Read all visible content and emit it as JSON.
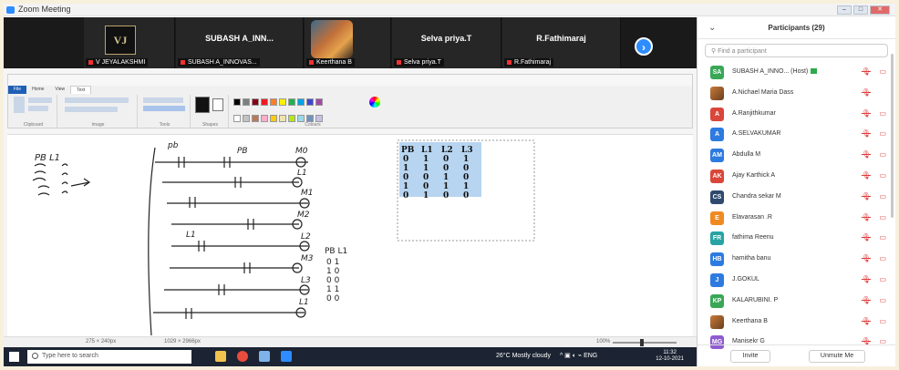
{
  "window": {
    "title": "Zoom Meeting"
  },
  "video_strip": {
    "tiles": [
      {
        "display": "VJ",
        "name": "V JEYALAKSHMI"
      },
      {
        "display": "SUBASH A_INN...",
        "name": "SUBASH A_INNOVAS..."
      },
      {
        "display": "",
        "name": "Keerthana B"
      },
      {
        "display": "Selva priya.T",
        "name": "Selva priya.T"
      },
      {
        "display": "R.Fathimaraj",
        "name": "R.Fathimaraj"
      }
    ],
    "next_glyph": "›"
  },
  "paint": {
    "tabs": [
      "File",
      "Home",
      "View",
      "Text"
    ],
    "groups": [
      "Clipboard",
      "Image",
      "Tools",
      "Shapes",
      "Colours"
    ],
    "status": {
      "pos1": "275 × 240px",
      "pos2": "1029 × 2966px",
      "zoom": "100%"
    }
  },
  "whiteboard": {
    "left_table_header": "PB  L1",
    "right_table_header": "PB  L1",
    "right_table_rows": [
      "0   1",
      "1   0",
      "0   0",
      "1   1",
      "0   0"
    ],
    "truth_table": {
      "headers": [
        "PB",
        "L1",
        "L2",
        "L3"
      ],
      "rows": [
        [
          "0",
          "1",
          "0",
          "1"
        ],
        [
          "1",
          "1",
          "0",
          "0"
        ],
        [
          "0",
          "0",
          "1",
          "0"
        ],
        [
          "1",
          "0",
          "1",
          "1"
        ],
        [
          "0",
          "1",
          "0",
          "0"
        ]
      ]
    },
    "ladder_labels": {
      "top": "pb",
      "pb": "PB",
      "m0": "M0",
      "l1_a": "L1",
      "m1": "M1",
      "m2": "M2",
      "l2": "L2",
      "m3": "M3",
      "l3": "L3",
      "l1_b": "L1",
      "l1_c": "L1"
    }
  },
  "taskbar": {
    "search_placeholder": "Type here to search",
    "weather": "26°C  Mostly cloudy",
    "time": "11:32",
    "date": "12-10-2021"
  },
  "participants_panel": {
    "title": "Participants (29)",
    "search_placeholder": "Find a participant",
    "invite_label": "Invite",
    "unmute_label": "Unmute Me",
    "list": [
      {
        "initials": "SA",
        "name": "SUBASH A_INNO... (Host)",
        "color": "#3aa757",
        "host": true
      },
      {
        "initials": "",
        "name": "A.Nichael Maria Dass",
        "color": "#8a6a5a",
        "image": true
      },
      {
        "initials": "A",
        "name": "A.Ranjithkumar",
        "color": "#d9473a"
      },
      {
        "initials": "A",
        "name": "A.SELVAKUMAR",
        "color": "#2d7be0"
      },
      {
        "initials": "AM",
        "name": "Abdulla M",
        "color": "#2d7be0"
      },
      {
        "initials": "AK",
        "name": "Ajay Karthick A",
        "color": "#d9473a"
      },
      {
        "initials": "CS",
        "name": "Chandra sekar M",
        "color": "#2f4a6e"
      },
      {
        "initials": "E",
        "name": "Elavarasan .R",
        "color": "#ef8a22"
      },
      {
        "initials": "FR",
        "name": "fathima Reenu",
        "color": "#28a3a3"
      },
      {
        "initials": "HB",
        "name": "hamitha banu",
        "color": "#2d7be0"
      },
      {
        "initials": "J",
        "name": "J.GOKUL",
        "color": "#2d7be0"
      },
      {
        "initials": "KP",
        "name": "KALARUBINI. P",
        "color": "#3aa757"
      },
      {
        "initials": "",
        "name": "Keerthana B",
        "color": "#c77b3a",
        "image": true
      },
      {
        "initials": "MG",
        "name": "Manisekr G",
        "color": "#8e5bd0"
      }
    ]
  }
}
